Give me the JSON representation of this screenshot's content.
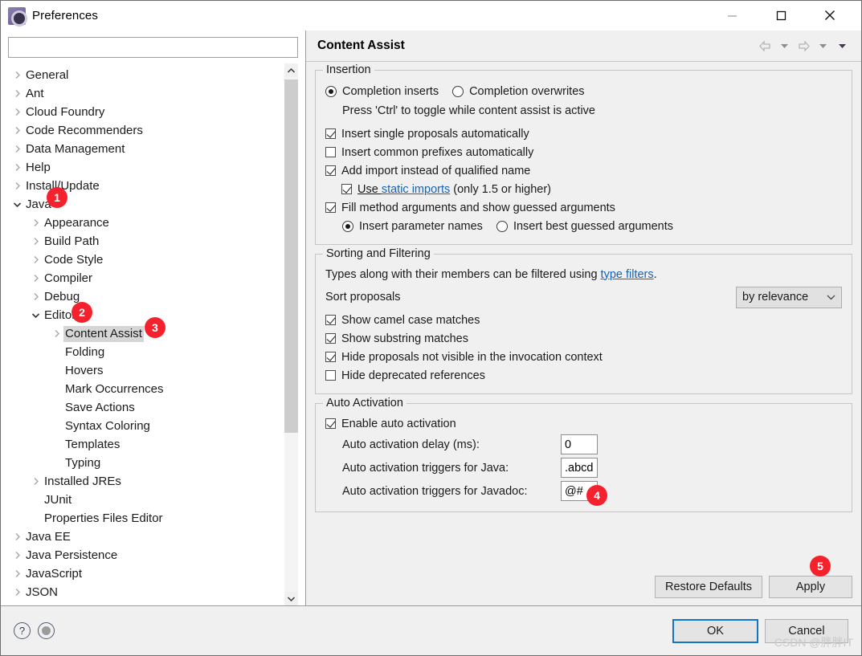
{
  "window": {
    "title": "Preferences",
    "icon": "preferences-gear-icon",
    "minimize_label": "Minimize",
    "maximize_label": "Maximize",
    "close_label": "Close"
  },
  "sidebar": {
    "filter_value": "",
    "filter_placeholder": "",
    "items": [
      {
        "label": "General",
        "level": 0,
        "expandable": true,
        "expanded": false,
        "selected": false
      },
      {
        "label": "Ant",
        "level": 0,
        "expandable": true,
        "expanded": false,
        "selected": false
      },
      {
        "label": "Cloud Foundry",
        "level": 0,
        "expandable": true,
        "expanded": false,
        "selected": false
      },
      {
        "label": "Code Recommenders",
        "level": 0,
        "expandable": true,
        "expanded": false,
        "selected": false
      },
      {
        "label": "Data Management",
        "level": 0,
        "expandable": true,
        "expanded": false,
        "selected": false
      },
      {
        "label": "Help",
        "level": 0,
        "expandable": true,
        "expanded": false,
        "selected": false
      },
      {
        "label": "Install/Update",
        "level": 0,
        "expandable": true,
        "expanded": false,
        "selected": false
      },
      {
        "label": "Java",
        "level": 0,
        "expandable": true,
        "expanded": true,
        "selected": false
      },
      {
        "label": "Appearance",
        "level": 1,
        "expandable": true,
        "expanded": false,
        "selected": false
      },
      {
        "label": "Build Path",
        "level": 1,
        "expandable": true,
        "expanded": false,
        "selected": false
      },
      {
        "label": "Code Style",
        "level": 1,
        "expandable": true,
        "expanded": false,
        "selected": false
      },
      {
        "label": "Compiler",
        "level": 1,
        "expandable": true,
        "expanded": false,
        "selected": false
      },
      {
        "label": "Debug",
        "level": 1,
        "expandable": true,
        "expanded": false,
        "selected": false
      },
      {
        "label": "Editor",
        "level": 1,
        "expandable": true,
        "expanded": true,
        "selected": false
      },
      {
        "label": "Content Assist",
        "level": 2,
        "expandable": true,
        "expanded": false,
        "selected": true
      },
      {
        "label": "Folding",
        "level": 2,
        "expandable": false,
        "expanded": false,
        "selected": false
      },
      {
        "label": "Hovers",
        "level": 2,
        "expandable": false,
        "expanded": false,
        "selected": false
      },
      {
        "label": "Mark Occurrences",
        "level": 2,
        "expandable": false,
        "expanded": false,
        "selected": false
      },
      {
        "label": "Save Actions",
        "level": 2,
        "expandable": false,
        "expanded": false,
        "selected": false
      },
      {
        "label": "Syntax Coloring",
        "level": 2,
        "expandable": false,
        "expanded": false,
        "selected": false
      },
      {
        "label": "Templates",
        "level": 2,
        "expandable": false,
        "expanded": false,
        "selected": false
      },
      {
        "label": "Typing",
        "level": 2,
        "expandable": false,
        "expanded": false,
        "selected": false
      },
      {
        "label": "Installed JREs",
        "level": 1,
        "expandable": true,
        "expanded": false,
        "selected": false
      },
      {
        "label": "JUnit",
        "level": 1,
        "expandable": false,
        "expanded": false,
        "selected": false
      },
      {
        "label": "Properties Files Editor",
        "level": 1,
        "expandable": false,
        "expanded": false,
        "selected": false
      },
      {
        "label": "Java EE",
        "level": 0,
        "expandable": true,
        "expanded": false,
        "selected": false
      },
      {
        "label": "Java Persistence",
        "level": 0,
        "expandable": true,
        "expanded": false,
        "selected": false
      },
      {
        "label": "JavaScript",
        "level": 0,
        "expandable": true,
        "expanded": false,
        "selected": false
      },
      {
        "label": "JSON",
        "level": 0,
        "expandable": true,
        "expanded": false,
        "selected": false
      }
    ]
  },
  "page": {
    "title": "Content Assist",
    "nav": {
      "back_icon": "arrow-left-icon",
      "back_menu_icon": "chevron-down-icon",
      "forward_icon": "arrow-right-icon",
      "forward_menu_icon": "chevron-down-icon",
      "view_menu_icon": "chevron-down-filled-icon"
    }
  },
  "insertion": {
    "group_label": "Insertion",
    "mode": {
      "inserts_label": "Completion inserts",
      "inserts_selected": true,
      "overwrites_label": "Completion overwrites",
      "overwrites_selected": false
    },
    "hint": "Press 'Ctrl' to toggle while content assist is active",
    "options": [
      {
        "label": "Insert single proposals automatically",
        "checked": true
      },
      {
        "label": "Insert common prefixes automatically",
        "checked": false
      },
      {
        "label": "Add import instead of qualified name",
        "checked": true
      }
    ],
    "static_imports": {
      "checked": true,
      "prefix": "Use ",
      "link": "static imports",
      "suffix": " (only 1.5 or higher)"
    },
    "fill_args": {
      "label": "Fill method arguments and show guessed arguments",
      "checked": true
    },
    "arg_mode": {
      "param_names_label": "Insert parameter names",
      "param_names_selected": true,
      "best_guessed_label": "Insert best guessed arguments",
      "best_guessed_selected": false
    }
  },
  "sorting": {
    "group_label": "Sorting and Filtering",
    "description_prefix": "Types along with their members can be filtered using ",
    "description_link": "type filters",
    "description_suffix": ".",
    "sort_label": "Sort proposals",
    "sort_value": "by relevance",
    "sort_arrow_icon": "chevron-down-icon",
    "options": [
      {
        "label": "Show camel case matches",
        "checked": true
      },
      {
        "label": "Show substring matches",
        "checked": true
      },
      {
        "label": "Hide proposals not visible in the invocation context",
        "checked": true
      },
      {
        "label": "Hide deprecated references",
        "checked": false
      }
    ]
  },
  "auto_activation": {
    "group_label": "Auto Activation",
    "enable": {
      "label": "Enable auto activation",
      "checked": true
    },
    "fields": [
      {
        "label": "Auto activation delay (ms):",
        "value": "0"
      },
      {
        "label": "Auto activation triggers for Java:",
        "value": ".abcd"
      },
      {
        "label": "Auto activation triggers for Javadoc:",
        "value": "@#"
      }
    ]
  },
  "buttons": {
    "restore_defaults": "Restore Defaults",
    "apply": "Apply",
    "ok": "OK",
    "cancel": "Cancel"
  },
  "footer": {
    "help_icon": "question-mark-icon",
    "help_glyph": "?",
    "secondary_icon": "filled-circle-icon"
  },
  "badges": {
    "b1": "1",
    "b2": "2",
    "b3": "3",
    "b4": "4",
    "b5": "5",
    "color": "#f5222d"
  },
  "watermark": "CSDN @胖胖IT"
}
